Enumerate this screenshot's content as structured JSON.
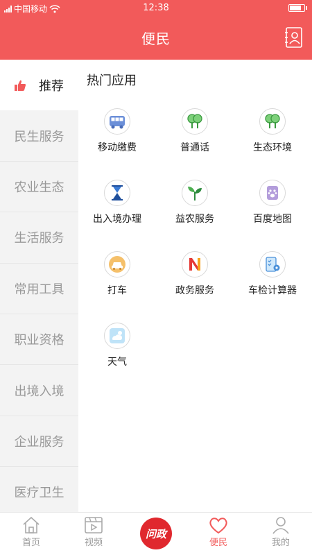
{
  "status": {
    "carrier": "中国移动",
    "time": "12:38"
  },
  "header": {
    "title": "便民"
  },
  "sidebar": {
    "items": [
      {
        "label": "推荐"
      },
      {
        "label": "民生服务"
      },
      {
        "label": "农业生态"
      },
      {
        "label": "生活服务"
      },
      {
        "label": "常用工具"
      },
      {
        "label": "职业资格"
      },
      {
        "label": "出境入境"
      },
      {
        "label": "企业服务"
      },
      {
        "label": "医疗卫生"
      }
    ]
  },
  "main": {
    "section_title": "热门应用",
    "apps": [
      {
        "label": "移动缴费",
        "icon": "bus-icon"
      },
      {
        "label": "普通话",
        "icon": "tree-icon"
      },
      {
        "label": "生态环境",
        "icon": "tree-icon"
      },
      {
        "label": "出入境办理",
        "icon": "hourglass-icon"
      },
      {
        "label": "益农服务",
        "icon": "sprout-icon"
      },
      {
        "label": "百度地图",
        "icon": "paw-icon"
      },
      {
        "label": "打车",
        "icon": "taxi-icon"
      },
      {
        "label": "政务服务",
        "icon": "letter-n-icon"
      },
      {
        "label": "车检计算器",
        "icon": "checklist-icon"
      },
      {
        "label": "天气",
        "icon": "weather-icon"
      }
    ]
  },
  "bottomnav": {
    "items": [
      {
        "label": "首页"
      },
      {
        "label": "视频"
      },
      {
        "label": "问政"
      },
      {
        "label": "便民"
      },
      {
        "label": "我的"
      }
    ]
  },
  "colors": {
    "brand": "#f25a5a",
    "badge": "#e0282e"
  }
}
